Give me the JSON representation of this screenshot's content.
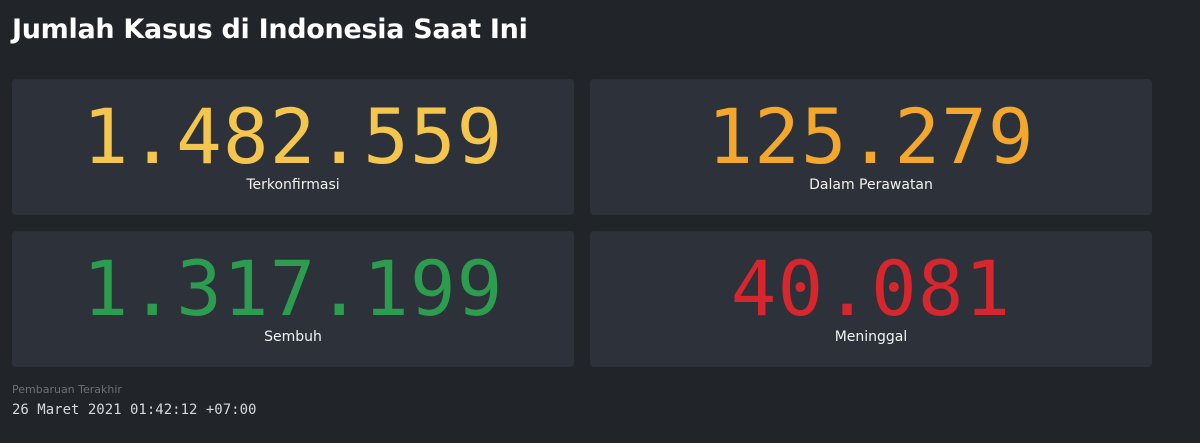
{
  "header": {
    "title": "Jumlah Kasus di Indonesia Saat Ini"
  },
  "stats": [
    {
      "value": "1.482.559",
      "label": "Terkonfirmasi",
      "color": "#f4c64e"
    },
    {
      "value": "125.279",
      "label": "Dalam Perawatan",
      "color": "#f3a72c"
    },
    {
      "value": "1.317.199",
      "label": "Sembuh",
      "color": "#2c9c4f"
    },
    {
      "value": "40.081",
      "label": "Meninggal",
      "color": "#d8262e"
    }
  ],
  "footer": {
    "updated_label": "Pembaruan Terakhir",
    "updated_time": "26 Maret 2021 01:42:12 +07:00"
  }
}
